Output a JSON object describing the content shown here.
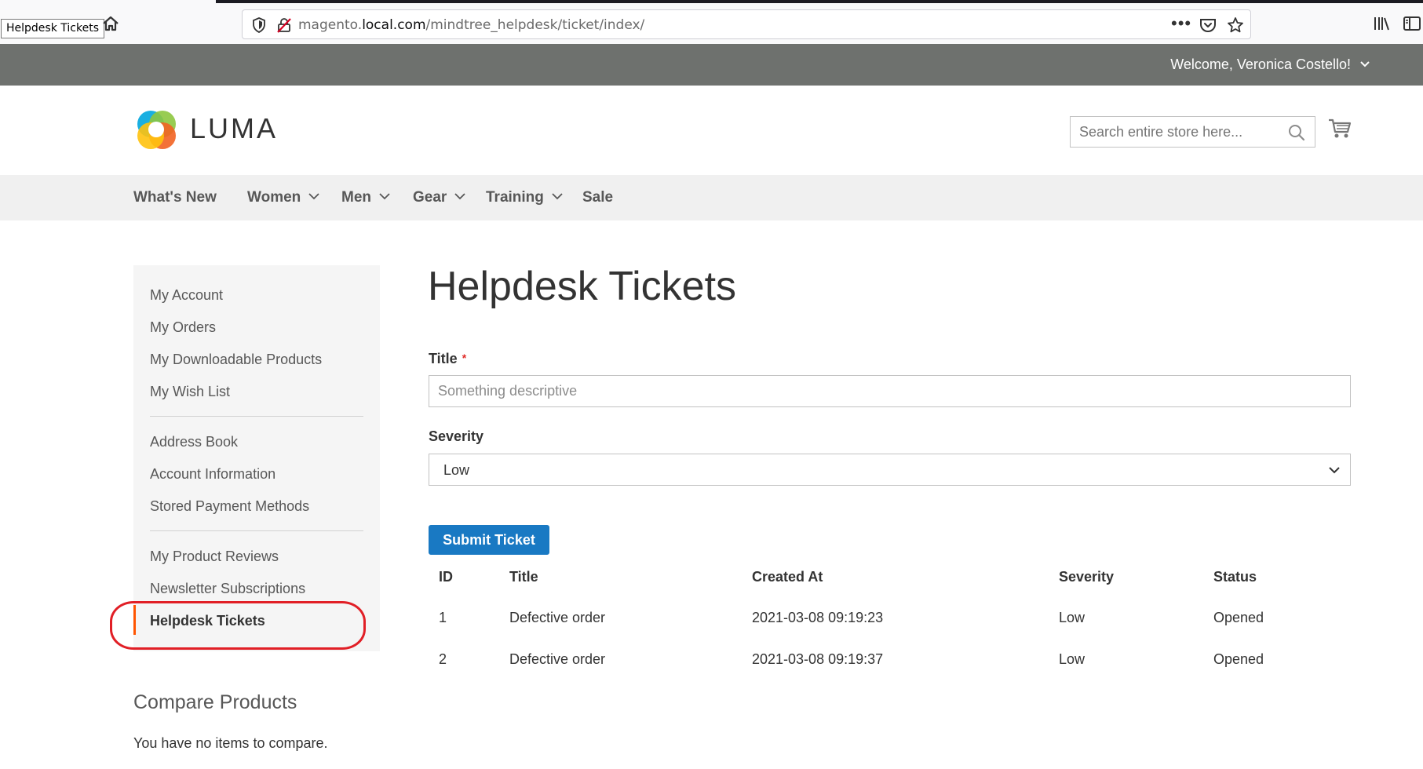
{
  "browser": {
    "tooltip": "Helpdesk Tickets",
    "url_prefix": "magento.",
    "url_domain": "local.com",
    "url_path": "/mindtree_helpdesk/ticket/index/",
    "more_label": "•••"
  },
  "header": {
    "welcome": "Welcome, Veronica Costello!"
  },
  "logo": {
    "text": "LUMA"
  },
  "search": {
    "placeholder": "Search entire store here..."
  },
  "nav": {
    "items": [
      {
        "label": "What's New",
        "has_caret": false
      },
      {
        "label": "Women",
        "has_caret": true
      },
      {
        "label": "Men",
        "has_caret": true
      },
      {
        "label": "Gear",
        "has_caret": true
      },
      {
        "label": "Training",
        "has_caret": true
      },
      {
        "label": "Sale",
        "has_caret": false
      }
    ]
  },
  "sidebar": {
    "items": [
      {
        "label": "My Account"
      },
      {
        "label": "My Orders"
      },
      {
        "label": "My Downloadable Products"
      },
      {
        "label": "My Wish List"
      },
      {
        "label": "Address Book"
      },
      {
        "label": "Account Information"
      },
      {
        "label": "Stored Payment Methods"
      },
      {
        "label": "My Product Reviews"
      },
      {
        "label": "Newsletter Subscriptions"
      },
      {
        "label": "Helpdesk Tickets",
        "current": true
      }
    ],
    "highlight_color": "#e11f26",
    "current_bar_color": "#ff5501"
  },
  "compare": {
    "title": "Compare Products",
    "empty": "You have no items to compare."
  },
  "main": {
    "page_title": "Helpdesk Tickets",
    "form": {
      "title_label": "Title",
      "required_mark": "*",
      "title_placeholder": "Something descriptive",
      "title_value": "",
      "severity_label": "Severity",
      "severity_value": "Low",
      "submit_label": "Submit Ticket"
    },
    "table": {
      "headers": [
        "ID",
        "Title",
        "Created At",
        "Severity",
        "Status"
      ],
      "rows": [
        [
          "1",
          "Defective order",
          "2021-03-08 09:19:23",
          "Low",
          "Opened"
        ],
        [
          "2",
          "Defective order",
          "2021-03-08 09:19:37",
          "Low",
          "Opened"
        ]
      ]
    }
  },
  "colors": {
    "brand_blue": "#1979c3",
    "panel_gray": "#6e716e",
    "nav_bg": "#f0f0f0",
    "sidebar_bg": "#f5f5f5"
  }
}
